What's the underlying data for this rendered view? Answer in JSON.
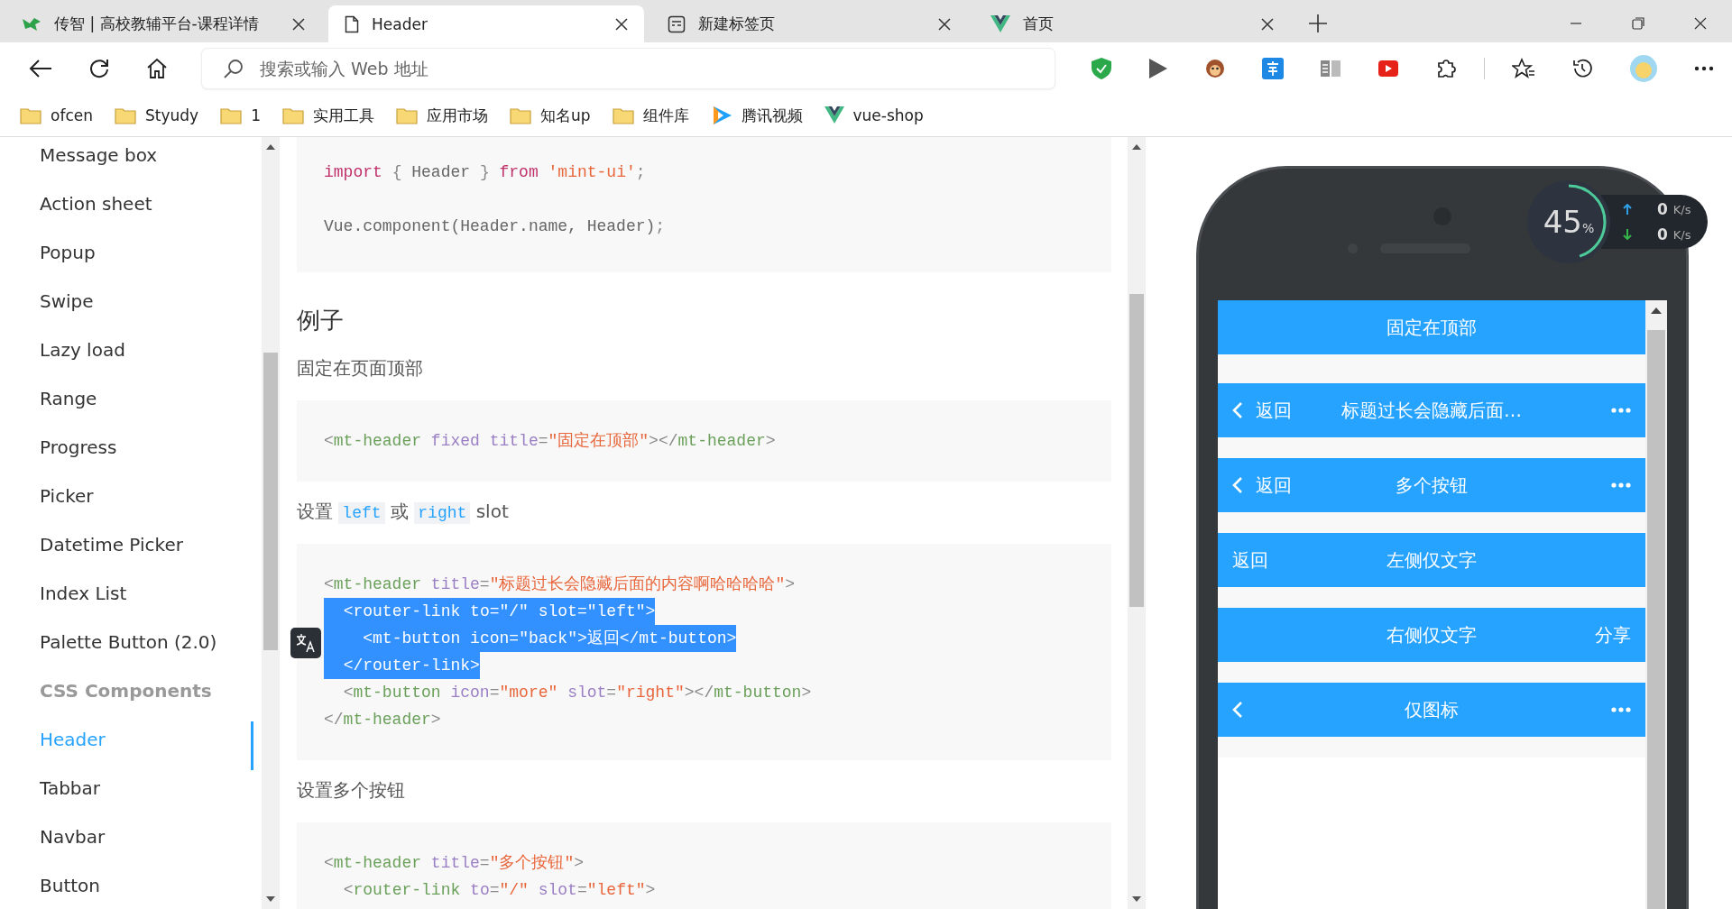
{
  "tabs": [
    {
      "title": "传智 | 高校教辅平台-课程详情",
      "selected": false
    },
    {
      "title": "Header",
      "selected": true
    },
    {
      "title": "新建标签页",
      "selected": false
    },
    {
      "title": "首页",
      "selected": false
    }
  ],
  "address_bar": {
    "placeholder": "搜索或输入 Web 地址"
  },
  "bookmarks": [
    {
      "label": "ofcen"
    },
    {
      "label": "Styudy"
    },
    {
      "label": "1"
    },
    {
      "label": "实用工具"
    },
    {
      "label": "应用市场"
    },
    {
      "label": "知名up"
    },
    {
      "label": "组件库"
    },
    {
      "label": "腾讯视频"
    },
    {
      "label": "vue-shop"
    }
  ],
  "sidebar": {
    "items": [
      {
        "label": "Message box",
        "kind": "link",
        "selected": false
      },
      {
        "label": "Action sheet",
        "kind": "link",
        "selected": false
      },
      {
        "label": "Popup",
        "kind": "link",
        "selected": false
      },
      {
        "label": "Swipe",
        "kind": "link",
        "selected": false
      },
      {
        "label": "Lazy load",
        "kind": "link",
        "selected": false
      },
      {
        "label": "Range",
        "kind": "link",
        "selected": false
      },
      {
        "label": "Progress",
        "kind": "link",
        "selected": false
      },
      {
        "label": "Picker",
        "kind": "link",
        "selected": false
      },
      {
        "label": "Datetime Picker",
        "kind": "link",
        "selected": false
      },
      {
        "label": "Index List",
        "kind": "link",
        "selected": false
      },
      {
        "label": "Palette Button (2.0)",
        "kind": "link",
        "selected": false
      },
      {
        "label": "CSS Components",
        "kind": "section",
        "selected": false
      },
      {
        "label": "Header",
        "kind": "link",
        "selected": true
      },
      {
        "label": "Tabbar",
        "kind": "link",
        "selected": false
      },
      {
        "label": "Navbar",
        "kind": "link",
        "selected": false
      },
      {
        "label": "Button",
        "kind": "link",
        "selected": false
      }
    ]
  },
  "content": [
    {
      "kind": "code",
      "lines": [
        {
          "text": "import { Header } from 'mint-ui';",
          "selected": false
        }
      ],
      "more_lines": [
        {
          "text": "Vue.component(Header.name, Header);",
          "selected": false
        }
      ]
    },
    {
      "kind": "heading",
      "text": "例子"
    },
    {
      "kind": "paragraph",
      "parts": [
        {
          "t": "固定在页面顶部",
          "code": false
        }
      ]
    },
    {
      "kind": "code",
      "lines": [
        {
          "text": "<mt-header fixed title=\"固定在顶部\"></mt-header>",
          "selected": false
        }
      ]
    },
    {
      "kind": "paragraph",
      "parts": [
        {
          "t": "设置 ",
          "code": false
        },
        {
          "t": "left",
          "code": true
        },
        {
          "t": " 或 ",
          "code": false
        },
        {
          "t": "right",
          "code": true
        },
        {
          "t": " slot",
          "code": false
        }
      ]
    },
    {
      "kind": "code",
      "lines": [
        {
          "text": "<mt-header title=\"标题过长会隐藏后面的内容啊哈哈哈哈\">",
          "selected": false
        },
        {
          "text": "  <router-link to=\"/\" slot=\"left\">",
          "selected": true
        },
        {
          "text": "    <mt-button icon=\"back\">返回</mt-button>",
          "selected": true
        },
        {
          "text": "  </router-link>",
          "selected": true
        },
        {
          "text": "  <mt-button icon=\"more\" slot=\"right\"></mt-button>",
          "selected": false
        },
        {
          "text": "</mt-header>",
          "selected": false
        }
      ]
    },
    {
      "kind": "paragraph",
      "parts": [
        {
          "t": "设置多个按钮",
          "code": false
        }
      ]
    },
    {
      "kind": "code",
      "lines": [
        {
          "text": "<mt-header title=\"多个按钮\">",
          "selected": false
        },
        {
          "text": "  <router-link to=\"/\" slot=\"left\">",
          "selected": false
        }
      ]
    }
  ],
  "speed_monitor": {
    "percent": "45",
    "percent_sign": "%",
    "level": 0.45,
    "upload": "0",
    "upload_unit": "K/s",
    "download": "0",
    "download_unit": "K/s"
  },
  "phone_headers": [
    {
      "back_arrow": false,
      "title": "固定在顶部",
      "more": false
    },
    {
      "back_arrow": true,
      "left_text": "返回",
      "title": "标题过长会隐藏后面…",
      "more": true
    },
    {
      "back_arrow": true,
      "left_text": "返回",
      "title": "多个按钮",
      "more": true
    },
    {
      "back_arrow": false,
      "left_text": "返回",
      "title": "左侧仅文字",
      "more": false
    },
    {
      "back_arrow": false,
      "title": "右侧仅文字",
      "right_text": "分享",
      "more": false
    },
    {
      "back_arrow": true,
      "title": "仅图标",
      "more": true
    }
  ]
}
